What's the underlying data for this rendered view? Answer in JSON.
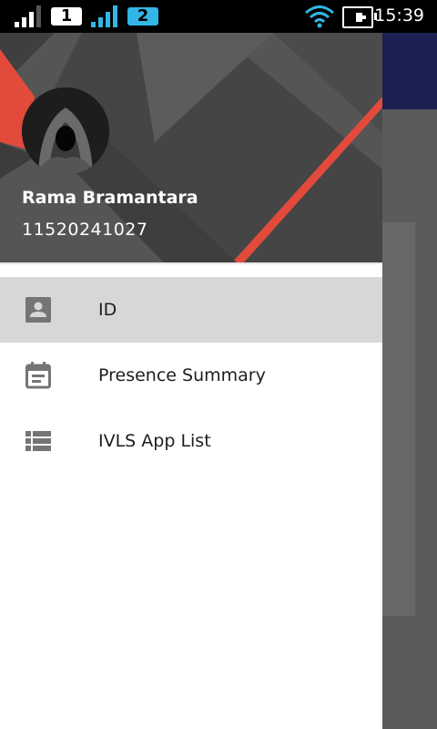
{
  "statusbar": {
    "sim1": "1",
    "sim2": "2",
    "time": "15:39",
    "colors": {
      "sim1_badge": "#ffffff",
      "sim2_badge": "#33b5e5"
    }
  },
  "drawer": {
    "user_name": "Rama Bramantara",
    "user_id": "11520241027",
    "items": [
      {
        "label": "ID",
        "icon": "account-box-icon",
        "selected": true
      },
      {
        "label": "Presence Summary",
        "icon": "calendar-icon",
        "selected": false
      },
      {
        "label": "IVLS App List",
        "icon": "list-icon",
        "selected": false
      }
    ]
  },
  "colors": {
    "accent_red": "#e24a3c",
    "app_bar": "#1b2150",
    "header_dark": "#4a4a4a",
    "selected_row": "#d7d7d7"
  }
}
